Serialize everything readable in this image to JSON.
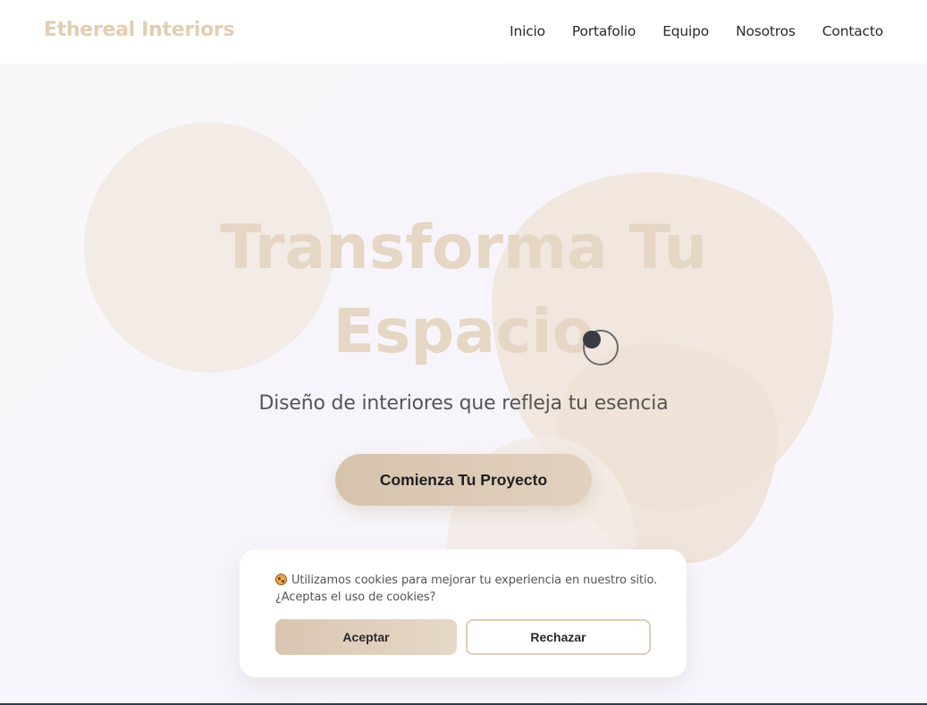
{
  "brand": {
    "name": "Ethereal Interiors",
    "color": "#e3cdb2"
  },
  "nav": {
    "items": [
      {
        "label": "Inicio"
      },
      {
        "label": "Portafolio"
      },
      {
        "label": "Equipo"
      },
      {
        "label": "Nosotros"
      },
      {
        "label": "Contacto"
      }
    ]
  },
  "hero": {
    "title_line1": "Transforma Tu",
    "title_line2": "Espacio",
    "subtitle": "Diseño de interiores que refleja tu esencia",
    "cta_label": "Comienza Tu Proyecto"
  },
  "cookie_banner": {
    "icon": "cookie-icon",
    "message_line1": "Utilizamos cookies para mejorar tu experiencia en nuestro sitio.",
    "message_line2": "¿Aceptas el uso de cookies?",
    "accept_label": "Aceptar",
    "reject_label": "Rechazar"
  },
  "colors": {
    "accent": "#d6c3ad",
    "title": "#e6d6c4",
    "background": "#f8f6fb"
  }
}
